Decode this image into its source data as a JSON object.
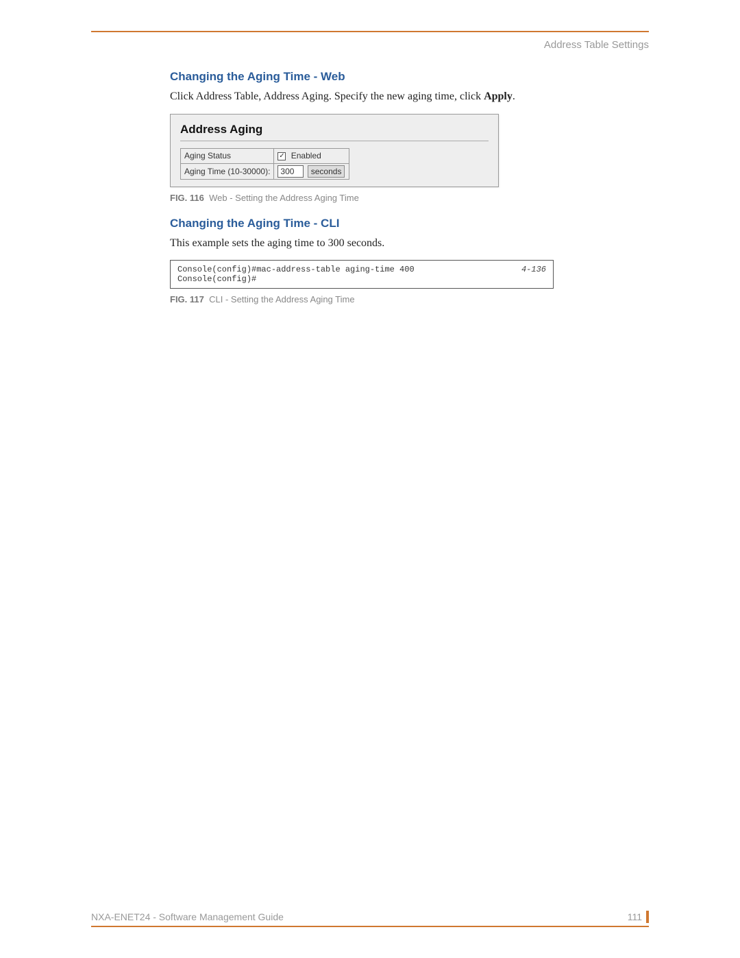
{
  "header": {
    "section_label": "Address Table Settings"
  },
  "sections": {
    "web_heading": "Changing the Aging Time - Web",
    "web_body_pre": "Click Address Table, Address Aging. Specify the new aging time, click ",
    "web_body_bold": "Apply",
    "web_body_post": ".",
    "cli_heading": "Changing the Aging Time - CLI",
    "cli_body": "This example sets the aging time to 300 seconds."
  },
  "fig116": {
    "title": "Address Aging",
    "row1_label": "Aging Status",
    "row1_check": "✓",
    "row1_text": "Enabled",
    "row2_label": "Aging Time (10-30000):",
    "row2_value": "300",
    "row2_units": "seconds",
    "caption_label": "FIG. 116",
    "caption_text": "Web - Setting the Address Aging Time"
  },
  "fig117": {
    "cli_line1": "Console(config)#mac-address-table aging-time 400",
    "cli_ref": "4-136",
    "cli_line2": "Console(config)#",
    "caption_label": "FIG. 117",
    "caption_text": "CLI - Setting the Address Aging Time"
  },
  "footer": {
    "doc_title": "NXA-ENET24 - Software Management Guide",
    "page_number": "111"
  }
}
